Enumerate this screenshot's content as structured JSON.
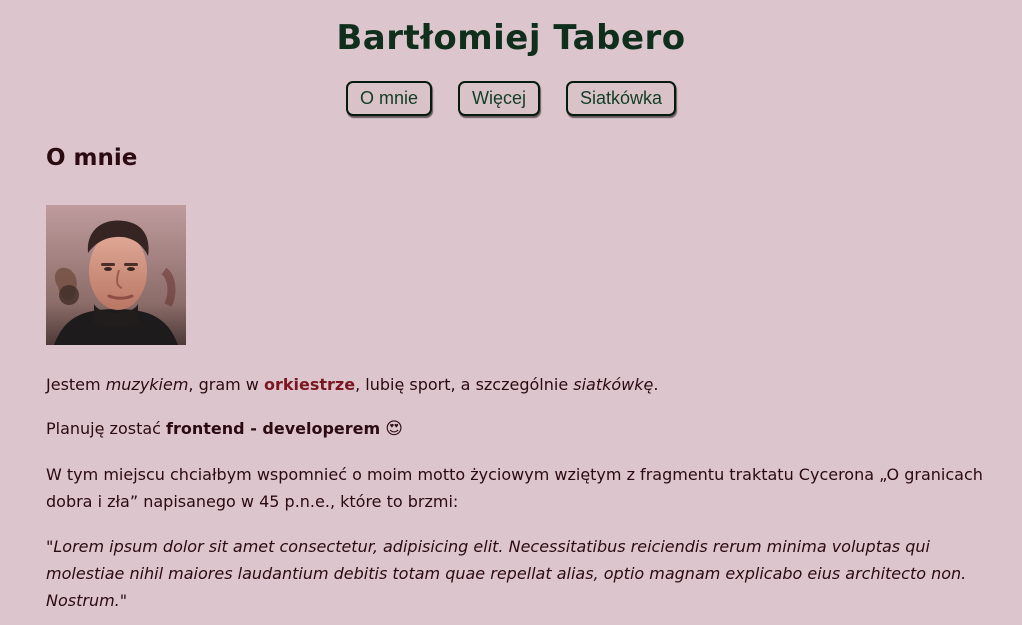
{
  "header": {
    "title": "Bartłomiej Tabero"
  },
  "nav": {
    "items": [
      {
        "label": "O mnie"
      },
      {
        "label": "Więcej"
      },
      {
        "label": "Siatkówka"
      }
    ]
  },
  "about": {
    "heading": "O mnie",
    "paragraph1": {
      "part1": "Jestem ",
      "musician": "muzykiem",
      "part2": ", gram w ",
      "orchestra": "orkiestrze",
      "part3": ", lubię sport, a szczególnie ",
      "volleyball": "siatkówkę",
      "part4": "."
    },
    "paragraph2": {
      "part1": "Planuję zostać ",
      "role": "frontend - developerem",
      "emoji": "😍"
    },
    "paragraph3": "W tym miejscu chciałbym wspomnieć o moim motto życiowym wziętym z fragmentu traktatu Cycerona „O granicach dobra i zła” napisanego w 45 p.n.e., które to brzmi:",
    "quote": "\"Lorem ipsum dolor sit amet consectetur, adipisicing elit. Necessitatibus reiciendis rerum minima voluptas qui molestiae nihil maiores laudantium debitis totam quae repellat alias, optio magnam explicabo eius architecto non. Nostrum.\""
  },
  "colors": {
    "background": "#dcc5cc",
    "title": "#0f2e1c",
    "nav_text": "#123d24",
    "body_text": "#2b0a12",
    "link_accent": "#7a1721"
  }
}
